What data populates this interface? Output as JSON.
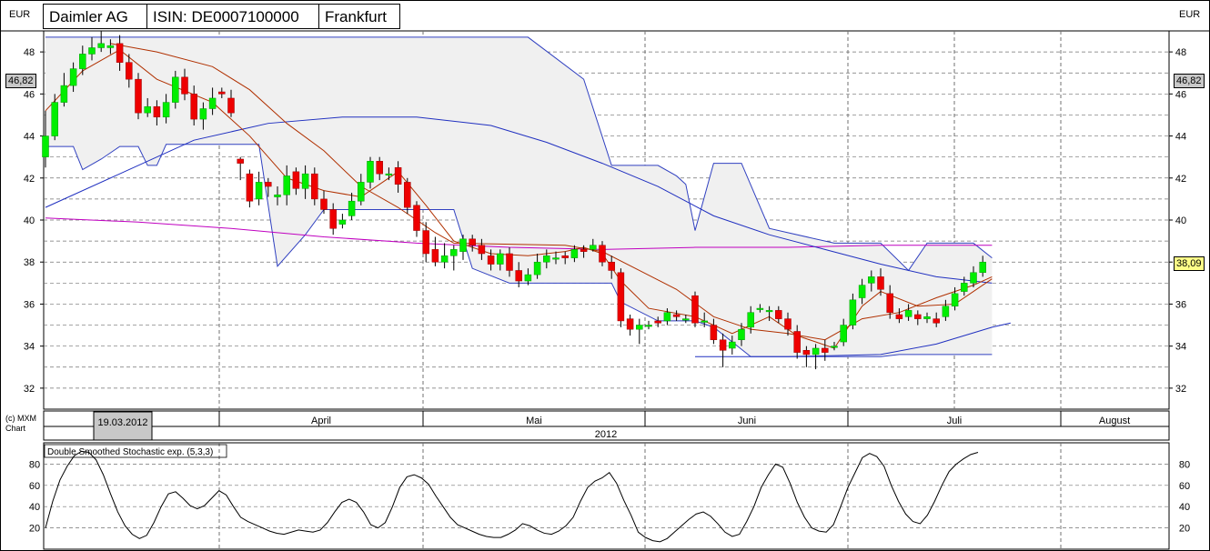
{
  "header": {
    "currency_left": "EUR",
    "currency_right": "EUR",
    "company": "Daimler AG",
    "isin": "ISIN: DE0007100000",
    "exchange": "Frankfurt"
  },
  "copyright": [
    "(c) MXM",
    "Chart"
  ],
  "colors": {
    "up": "#00ee00",
    "down": "#ee0000",
    "ma_short": "#b03000",
    "ma_long": "#2030c0",
    "ma_200": "#c000c0",
    "band": "#3040c0",
    "band_fill": "#f0f0f0",
    "grid": "#707070"
  },
  "chart_data": [
    {
      "type": "candlestick",
      "yaxis": {
        "min": 31,
        "max": 49,
        "ticks": [
          32,
          34,
          36,
          38,
          40,
          42,
          44,
          46,
          48
        ]
      },
      "price_tags": {
        "high": "46,82",
        "last": "38,09"
      },
      "x_axis": {
        "months": [
          "April",
          "Mai",
          "Juni",
          "Juli",
          "August"
        ],
        "year": "2012",
        "highlight_date": "19.03.2012"
      },
      "candles": [
        [
          43.0,
          44.0,
          45.2,
          42.5
        ],
        [
          44.0,
          45.6,
          46.0,
          43.8
        ],
        [
          45.6,
          46.4,
          47.0,
          45.4
        ],
        [
          46.4,
          47.2,
          47.5,
          46.1
        ],
        [
          47.2,
          47.9,
          48.3,
          46.9
        ],
        [
          47.9,
          48.2,
          48.7,
          47.6
        ],
        [
          48.2,
          48.4,
          49.0,
          48.0
        ],
        [
          48.2,
          48.3,
          48.6,
          47.9
        ],
        [
          48.4,
          47.5,
          48.8,
          47.1
        ],
        [
          47.5,
          46.7,
          47.9,
          46.3
        ],
        [
          46.7,
          45.1,
          47.0,
          44.8
        ],
        [
          45.1,
          45.4,
          45.8,
          44.9
        ],
        [
          45.4,
          44.9,
          45.7,
          44.5
        ],
        [
          44.9,
          45.6,
          46.0,
          44.6
        ],
        [
          45.6,
          46.8,
          47.1,
          45.3
        ],
        [
          46.8,
          46.0,
          47.2,
          45.7
        ],
        [
          46.0,
          44.8,
          46.4,
          44.5
        ],
        [
          44.8,
          45.3,
          45.6,
          44.3
        ],
        [
          45.3,
          45.8,
          46.3,
          45.0
        ],
        [
          46.1,
          46.0,
          46.3,
          45.8
        ],
        [
          45.8,
          45.1,
          46.2,
          44.9
        ],
        [
          42.9,
          42.7,
          43.0,
          41.9
        ],
        [
          42.2,
          40.9,
          42.4,
          40.6
        ],
        [
          41.0,
          41.8,
          42.3,
          40.7
        ],
        [
          41.8,
          41.6,
          42.0,
          41.1
        ],
        [
          41.1,
          41.2,
          41.6,
          40.7
        ],
        [
          41.2,
          42.1,
          42.6,
          40.7
        ],
        [
          42.3,
          41.5,
          42.5,
          41.2
        ],
        [
          41.5,
          42.2,
          42.6,
          41.0
        ],
        [
          42.2,
          41.0,
          42.5,
          40.7
        ],
        [
          41.0,
          40.5,
          41.4,
          40.3
        ],
        [
          40.5,
          39.6,
          40.8,
          39.3
        ],
        [
          39.8,
          40.0,
          40.3,
          39.6
        ],
        [
          40.2,
          40.9,
          41.3,
          40.0
        ],
        [
          40.9,
          41.8,
          42.2,
          40.7
        ],
        [
          41.8,
          42.8,
          43.0,
          41.5
        ],
        [
          42.8,
          42.2,
          43.0,
          41.9
        ],
        [
          42.2,
          42.2,
          42.5,
          41.9
        ],
        [
          42.5,
          41.7,
          42.8,
          41.3
        ],
        [
          41.8,
          40.6,
          42.0,
          40.3
        ],
        [
          40.7,
          39.5,
          40.9,
          39.2
        ],
        [
          39.5,
          38.4,
          39.9,
          38.0
        ],
        [
          38.6,
          38.0,
          39.2,
          37.8
        ],
        [
          38.0,
          38.3,
          38.9,
          37.7
        ],
        [
          38.3,
          38.6,
          38.8,
          37.6
        ],
        [
          38.5,
          39.1,
          39.3,
          38.1
        ],
        [
          39.1,
          38.8,
          39.3,
          38.5
        ],
        [
          38.8,
          38.4,
          39.1,
          38.1
        ],
        [
          38.3,
          37.9,
          38.6,
          37.6
        ],
        [
          37.9,
          38.4,
          38.6,
          37.6
        ],
        [
          38.4,
          37.6,
          38.7,
          37.3
        ],
        [
          37.6,
          37.1,
          38.0,
          36.8
        ],
        [
          37.1,
          37.4,
          37.7,
          36.9
        ],
        [
          37.4,
          38.0,
          38.4,
          37.2
        ],
        [
          38.0,
          38.3,
          38.6,
          37.7
        ],
        [
          38.2,
          38.2,
          38.5,
          37.9
        ],
        [
          38.3,
          38.2,
          38.5,
          37.9
        ],
        [
          38.2,
          38.6,
          38.8,
          38.0
        ],
        [
          38.6,
          38.5,
          38.8,
          38.2
        ],
        [
          38.6,
          38.8,
          39.1,
          38.5
        ],
        [
          38.8,
          38.0,
          39.0,
          37.8
        ],
        [
          38.0,
          37.6,
          38.3,
          37.2
        ],
        [
          37.5,
          35.2,
          37.7,
          34.9
        ],
        [
          35.3,
          34.8,
          35.5,
          34.5
        ],
        [
          34.8,
          35.0,
          35.3,
          34.1
        ],
        [
          35.0,
          35.0,
          35.2,
          34.8
        ],
        [
          35.2,
          35.1,
          35.4,
          34.9
        ],
        [
          35.2,
          35.6,
          35.8,
          35.0
        ],
        [
          35.5,
          35.4,
          35.7,
          35.2
        ],
        [
          35.3,
          35.3,
          35.5,
          35.1
        ],
        [
          36.4,
          35.1,
          36.6,
          34.9
        ],
        [
          35.2,
          35.2,
          35.6,
          34.9
        ],
        [
          35.0,
          34.3,
          35.3,
          34.1
        ],
        [
          34.3,
          33.8,
          34.6,
          33.0
        ],
        [
          33.9,
          34.2,
          34.5,
          33.6
        ],
        [
          34.3,
          34.8,
          35.1,
          34.0
        ],
        [
          34.9,
          35.6,
          35.9,
          34.6
        ],
        [
          35.8,
          35.8,
          36.0,
          35.6
        ],
        [
          35.7,
          35.7,
          35.9,
          35.2
        ],
        [
          35.7,
          35.3,
          35.9,
          35.1
        ],
        [
          35.3,
          34.8,
          35.6,
          34.5
        ],
        [
          34.7,
          33.7,
          35.0,
          33.4
        ],
        [
          33.8,
          33.6,
          34.0,
          33.0
        ],
        [
          33.6,
          33.9,
          34.1,
          32.9
        ],
        [
          33.9,
          33.7,
          34.3,
          33.3
        ],
        [
          34.0,
          34.0,
          34.2,
          33.8
        ],
        [
          34.2,
          35.0,
          35.3,
          34.0
        ],
        [
          35.0,
          36.2,
          36.5,
          34.8
        ],
        [
          36.3,
          36.9,
          37.2,
          36.0
        ],
        [
          37.0,
          37.3,
          37.6,
          36.6
        ],
        [
          37.3,
          36.7,
          37.7,
          36.4
        ],
        [
          36.5,
          35.6,
          36.9,
          35.3
        ],
        [
          35.5,
          35.3,
          35.8,
          35.1
        ],
        [
          35.4,
          35.7,
          36.0,
          35.2
        ],
        [
          35.5,
          35.3,
          35.7,
          35.0
        ],
        [
          35.3,
          35.4,
          35.6,
          35.1
        ],
        [
          35.3,
          35.1,
          35.6,
          34.9
        ],
        [
          35.4,
          35.9,
          36.2,
          35.2
        ],
        [
          35.9,
          36.5,
          36.8,
          35.7
        ],
        [
          36.6,
          37.0,
          37.3,
          36.4
        ],
        [
          37.0,
          37.5,
          37.8,
          36.8
        ],
        [
          37.5,
          38.0,
          38.3,
          37.3
        ]
      ],
      "band_upper": [
        [
          0,
          48.7
        ],
        [
          27,
          48.7
        ],
        [
          52,
          48.7
        ],
        [
          58,
          46.7
        ],
        [
          61,
          42.6
        ],
        [
          66,
          42.6
        ],
        [
          68,
          42.1
        ],
        [
          69,
          41.7
        ],
        [
          70,
          39.5
        ],
        [
          72,
          42.7
        ],
        [
          75,
          42.7
        ],
        [
          78,
          39.6
        ],
        [
          85,
          38.9
        ],
        [
          90,
          38.9
        ],
        [
          93,
          37.6
        ],
        [
          95,
          38.9
        ],
        [
          100,
          38.9
        ],
        [
          102,
          38.2
        ]
      ],
      "band_lower": [
        [
          0,
          43.5
        ],
        [
          3,
          43.5
        ],
        [
          4,
          42.4
        ],
        [
          6,
          42.9
        ],
        [
          8,
          43.5
        ],
        [
          10,
          43.5
        ],
        [
          11,
          42.6
        ],
        [
          12,
          42.6
        ],
        [
          13,
          43.6
        ],
        [
          23,
          43.6
        ],
        [
          25,
          37.8
        ],
        [
          28,
          39.3
        ],
        [
          30,
          40.5
        ],
        [
          44,
          40.5
        ],
        [
          46,
          37.7
        ],
        [
          50,
          37.0
        ],
        [
          61,
          37.0
        ],
        [
          62,
          36.1
        ],
        [
          66,
          35.2
        ],
        [
          70,
          35.2
        ],
        [
          72,
          34.9
        ],
        [
          76,
          33.5
        ],
        [
          90,
          33.5
        ],
        [
          92,
          33.6
        ],
        [
          102,
          33.6
        ]
      ],
      "ma_short": [
        [
          0,
          45.2
        ],
        [
          4,
          47.1
        ],
        [
          8,
          48.1
        ],
        [
          12,
          46.7
        ],
        [
          18,
          45.6
        ],
        [
          22,
          44.0
        ],
        [
          26,
          42.0
        ],
        [
          30,
          41.4
        ],
        [
          34,
          41.1
        ],
        [
          38,
          42.3
        ],
        [
          41,
          40.7
        ],
        [
          44,
          39.0
        ],
        [
          48,
          38.4
        ],
        [
          52,
          38.3
        ],
        [
          56,
          38.5
        ],
        [
          58,
          38.7
        ],
        [
          60,
          38.4
        ],
        [
          62,
          37.1
        ],
        [
          65,
          35.8
        ],
        [
          70,
          35.4
        ],
        [
          74,
          34.6
        ],
        [
          78,
          35.4
        ],
        [
          81,
          34.5
        ],
        [
          85,
          33.9
        ],
        [
          88,
          35.9
        ],
        [
          90,
          36.6
        ],
        [
          94,
          35.9
        ],
        [
          98,
          36.0
        ],
        [
          102,
          37.2
        ]
      ],
      "ma_mid": [
        [
          7,
          48.4
        ],
        [
          12,
          48.0
        ],
        [
          18,
          47.3
        ],
        [
          22,
          46.2
        ],
        [
          26,
          44.6
        ],
        [
          30,
          43.3
        ],
        [
          34,
          41.6
        ],
        [
          38,
          40.6
        ],
        [
          42,
          39.4
        ],
        [
          44,
          38.9
        ],
        [
          56,
          38.8
        ],
        [
          60,
          38.5
        ],
        [
          64,
          37.6
        ],
        [
          68,
          36.7
        ],
        [
          72,
          35.4
        ],
        [
          76,
          34.8
        ],
        [
          80,
          34.6
        ],
        [
          84,
          34.3
        ],
        [
          88,
          35.3
        ],
        [
          92,
          35.6
        ],
        [
          96,
          36.3
        ],
        [
          100,
          36.9
        ],
        [
          102,
          37.3
        ]
      ],
      "ma_long": [
        [
          0,
          40.6
        ],
        [
          8,
          42.2
        ],
        [
          16,
          43.8
        ],
        [
          24,
          44.6
        ],
        [
          32,
          44.9
        ],
        [
          40,
          44.9
        ],
        [
          48,
          44.5
        ],
        [
          54,
          43.7
        ],
        [
          60,
          42.7
        ],
        [
          66,
          41.6
        ],
        [
          72,
          40.2
        ],
        [
          78,
          39.3
        ],
        [
          84,
          38.6
        ],
        [
          90,
          37.9
        ],
        [
          96,
          37.3
        ],
        [
          102,
          37.0
        ]
      ],
      "ma_longest": [
        [
          0,
          40.1
        ],
        [
          10,
          39.9
        ],
        [
          20,
          39.6
        ],
        [
          30,
          39.2
        ],
        [
          40,
          38.9
        ],
        [
          50,
          38.7
        ],
        [
          60,
          38.6
        ],
        [
          70,
          38.7
        ],
        [
          80,
          38.7
        ],
        [
          90,
          38.8
        ],
        [
          102,
          38.8
        ]
      ],
      "band_lower_slow": [
        [
          70,
          33.5
        ],
        [
          80,
          33.5
        ],
        [
          90,
          33.6
        ],
        [
          96,
          34.1
        ],
        [
          102,
          34.9
        ],
        [
          104,
          35.1
        ]
      ]
    },
    {
      "type": "line",
      "title": "Double Smoothed Stochastic exp. (5,3,3)",
      "yaxis": {
        "min": 0,
        "max": 100,
        "ticks": [
          20,
          40,
          60,
          80
        ]
      },
      "values": [
        20,
        45,
        65,
        78,
        88,
        92,
        91,
        84,
        70,
        52,
        35,
        22,
        14,
        10,
        13,
        25,
        40,
        52,
        54,
        48,
        41,
        38,
        41,
        48,
        55,
        51,
        40,
        30,
        26,
        23,
        20,
        17,
        15,
        14,
        16,
        18,
        17,
        16,
        18,
        25,
        35,
        44,
        47,
        44,
        35,
        23,
        20,
        25,
        40,
        58,
        68,
        70,
        67,
        61,
        50,
        40,
        30,
        23,
        20,
        17,
        14,
        12,
        11,
        11,
        14,
        18,
        24,
        22,
        18,
        15,
        14,
        17,
        22,
        30,
        45,
        58,
        64,
        67,
        72,
        62,
        46,
        32,
        16,
        11,
        8,
        7,
        10,
        16,
        22,
        28,
        33,
        35,
        31,
        24,
        16,
        12,
        14,
        26,
        40,
        58,
        70,
        80,
        77,
        62,
        44,
        30,
        20,
        17,
        16,
        23,
        40,
        58,
        72,
        86,
        90,
        87,
        78,
        60,
        45,
        33,
        26,
        24,
        32,
        45,
        60,
        73,
        80,
        85,
        89,
        91
      ]
    }
  ]
}
